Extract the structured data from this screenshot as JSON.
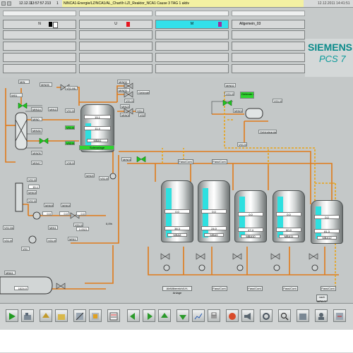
{
  "titlebar": {
    "date": "12.12.11",
    "time": "13:57:57.213",
    "index": "1",
    "message": "NINCA1-Energie/LZ/NCA1/AL_Chart\\h LZI_Reaktor_NCA1 Cause 3 TAG 1 aktiv",
    "datetime_right": "12.12.2011 14:41:51"
  },
  "header": {
    "area_labels": [
      "N",
      "U",
      "M",
      "Allgemein_03"
    ],
    "area_markers": {
      "N": "#000000",
      "U": "#e6141e",
      "M": "#9b2fa0"
    }
  },
  "brand": {
    "logo": "SIEMENS",
    "product": "PCS 7",
    "accent": "#0a8a8a"
  },
  "process": {
    "tags_left": [
      "MIN",
      "MIN05",
      "V01.ML",
      "W01",
      "MIN14",
      "MIN13",
      "MIN0",
      "V01.ML",
      "MIN30",
      "V01.ML",
      "V02.ML",
      "V05.ML",
      "MIN05",
      "MIN47",
      "V01.ML",
      "MIN04",
      "V01.ML",
      "MIN06",
      "MIN04",
      "V01.ML",
      "MIN1",
      "V01.ML",
      "V01.ML",
      "MIN1",
      "V01.ML",
      "V01"
    ],
    "tags_top": [
      "MIN03",
      "MIN03",
      "V01.ML",
      "Gebinde",
      "MIN21",
      "MIN01",
      "V01.ML",
      "MIN20",
      "V01.ML",
      "V02"
    ],
    "tags_top_right": [
      "MIN02",
      "V01.ML",
      "Gebinde anlage",
      "MIN02",
      "V01.ML",
      "Gebindeanlage",
      "MIN01",
      "V01.ML"
    ],
    "left_values": [
      "15.1",
      "0,0",
      "0,0",
      "0,0",
      "0,0521",
      "0,0%"
    ],
    "reactor_values": [
      "11,4",
      "15,1"
    ],
    "vessels": [
      {
        "name": "MBA1",
        "footer": "Solevorlage",
        "value": "11,4"
      },
      {
        "name": "MBA8",
        "value": "38,3"
      },
      {
        "name": "MBA9",
        "value": "24,0"
      },
      {
        "name": "MBA10",
        "value": "47,4"
      },
      {
        "name": "MBA11",
        "value": "60,0"
      },
      {
        "name": "MBA12",
        "value": "81,3"
      }
    ],
    "vessel_small_values": [
      "0,0",
      "0,0",
      "0,0",
      "0,0",
      "0,0",
      "0,0",
      "0,0",
      "0,0"
    ],
    "bottom_labels": [
      "Abfüllbereich/LH-Anlage",
      "Fass/Cont.",
      "Fass/Cont.",
      "Fass/Cont.",
      "Fass/Cont.",
      "Fass/Cont.",
      "Fass/Cont."
    ],
    "bottom_left_tag": "MBA1",
    "bottom_left_value": "1024,0",
    "right_label": "nach MPA 07",
    "pipe_color": "#e07a1a",
    "signal_color": "#e8a218",
    "highlight_green": "#2fd52f",
    "level_cyan": "#2ee0e0"
  },
  "toolbar": {
    "buttons": [
      "Übersicht",
      "Anlage",
      "Zurück",
      "Vor",
      "Bildwahl",
      "Gruppe",
      "Meldung",
      "Kurve",
      "Bild links",
      "Bild rechts",
      "Bild oben",
      "Bild unten",
      "Drucken",
      "Hilfe",
      "Quittieren",
      "Hupe",
      "Sammel",
      "Einstellungen",
      "Lupe",
      "Archiv",
      "Benutzer",
      "Diagnose"
    ]
  }
}
